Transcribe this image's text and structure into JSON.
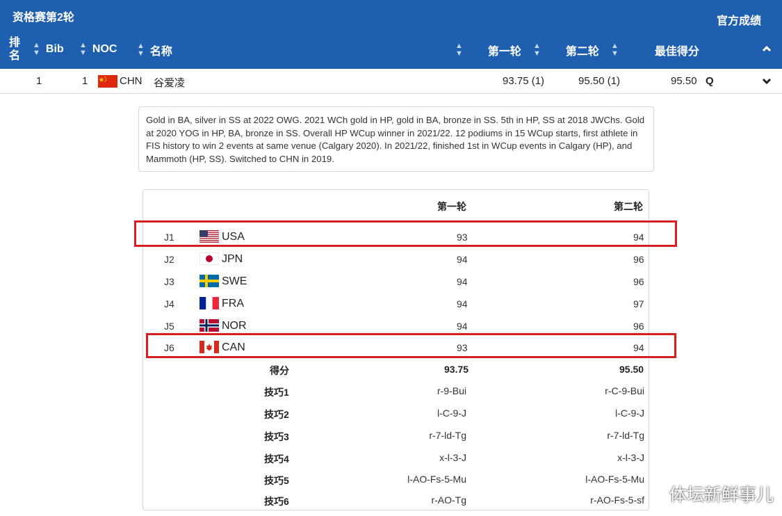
{
  "header": {
    "title": "资格赛第2轮",
    "official_results": "官方成绩",
    "columns": {
      "rank": "排名",
      "bib": "Bib",
      "noc": "NOC",
      "name": "名称",
      "run1": "第一轮",
      "run2": "第二轮",
      "best": "最佳得分"
    }
  },
  "athlete": {
    "rank": "1",
    "bib": "1",
    "noc": "CHN",
    "name": "谷爱凌",
    "run1": "93.75 (1)",
    "run2": "95.50 (1)",
    "best": "95.50",
    "qualified": "Q"
  },
  "bio": "Gold in BA, silver in SS at 2022 OWG. 2021 WCh gold in HP, gold in BA, bronze in SS. 5th in HP, SS at 2018 JWChs. Gold at 2020 YOG in HP, BA, bronze in SS. Overall HP WCup winner in 2021/22. 12 podiums in 15 WCup starts, first athlete in FIS history to win 2 events at same venue (Calgary 2020). In 2021/22, finished 1st in WCup events in Calgary (HP), and Mammoth (HP, SS). Switched to CHN in 2019.",
  "judges_table": {
    "col_run1": "第一轮",
    "col_run2": "第二轮",
    "judges": [
      {
        "id": "J1",
        "noc": "USA",
        "run1": "93",
        "run2": "94"
      },
      {
        "id": "J2",
        "noc": "JPN",
        "run1": "94",
        "run2": "96"
      },
      {
        "id": "J3",
        "noc": "SWE",
        "run1": "94",
        "run2": "96"
      },
      {
        "id": "J4",
        "noc": "FRA",
        "run1": "94",
        "run2": "97"
      },
      {
        "id": "J5",
        "noc": "NOR",
        "run1": "94",
        "run2": "96"
      },
      {
        "id": "J6",
        "noc": "CAN",
        "run1": "93",
        "run2": "94"
      }
    ],
    "score": {
      "label": "得分",
      "run1": "93.75",
      "run2": "95.50"
    },
    "tricks": [
      {
        "label": "技巧1",
        "run1": "r-9-Bui",
        "run2": "r-C-9-Bui"
      },
      {
        "label": "技巧2",
        "run1": "l-C-9-J",
        "run2": "l-C-9-J"
      },
      {
        "label": "技巧3",
        "run1": "r-7-ld-Tg",
        "run2": "r-7-ld-Tg"
      },
      {
        "label": "技巧4",
        "run1": "x-l-3-J",
        "run2": "x-l-3-J"
      },
      {
        "label": "技巧5",
        "run1": "l-AO-Fs-5-Mu",
        "run2": "l-AO-Fs-5-Mu"
      },
      {
        "label": "技巧6",
        "run1": "r-AO-Tg",
        "run2": "r-AO-Fs-5-sf"
      }
    ]
  },
  "watermark": "体坛新鲜事儿",
  "colors": {
    "header_bg": "#1f5fb0",
    "highlight": "#d81e1e"
  },
  "icons": {
    "sort": "sort-arrows-icon",
    "collapse": "chevron-up-icon",
    "expand": "chevron-down-icon"
  }
}
